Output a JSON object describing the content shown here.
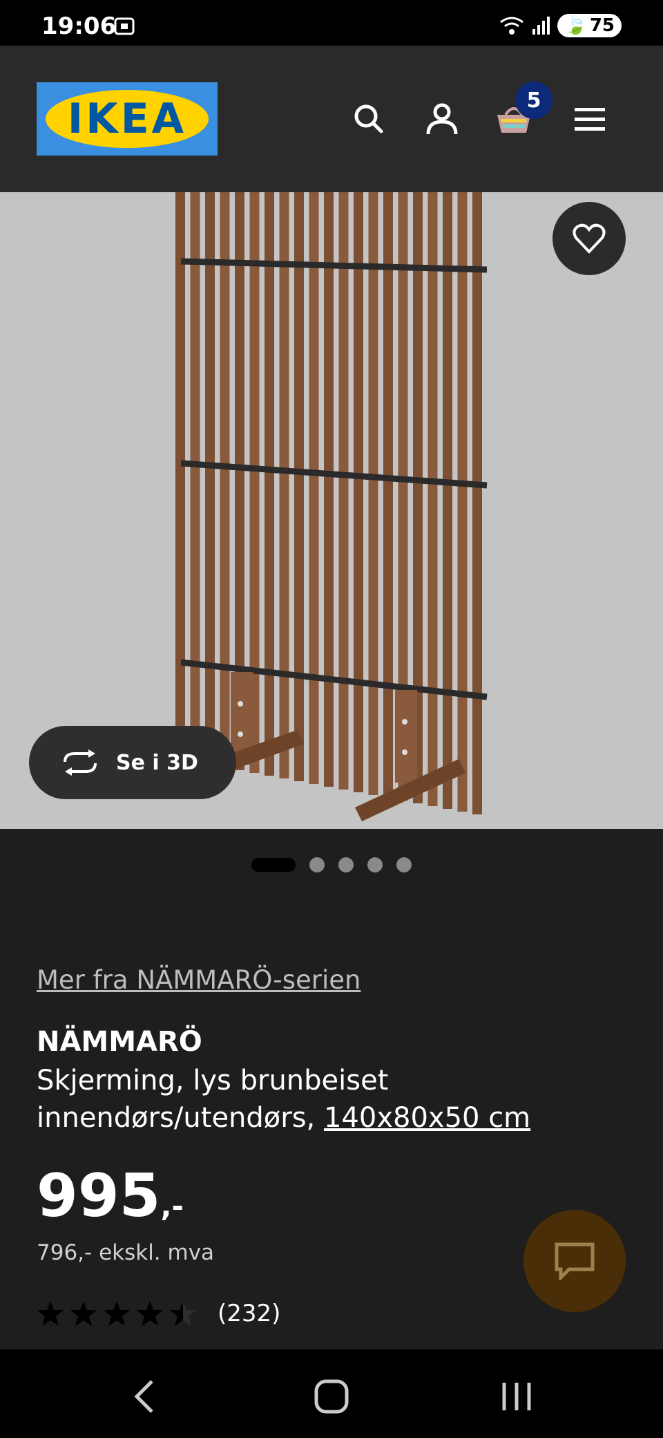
{
  "status_bar": {
    "time": "19:06",
    "battery": "75"
  },
  "header": {
    "logo_text": "IKEA",
    "cart_count": "5",
    "icons": [
      "search-icon",
      "user-icon",
      "cart-icon",
      "menu-icon"
    ]
  },
  "hero": {
    "see_3d_label": "Se i 3D",
    "carousel_total": 5,
    "carousel_active": 1
  },
  "product": {
    "series_link": "Mer fra NÄMMARÖ-serien",
    "name": "NÄMMARÖ",
    "description_line1": "Skjerming, lys brunbeiset",
    "description_line2": "innendørs/utendørs,",
    "size_link": "140x80x50 cm",
    "price": "995",
    "price_suffix": ",-",
    "price_excl_vat": "796,- ekskl. mva",
    "rating_value": 4.5,
    "rating_max": 5,
    "review_count": "(232)"
  },
  "colors": {
    "logo_blue": "#3b8fe0",
    "logo_yellow": "#ffd200",
    "badge_blue": "#0b2a7a",
    "wood": "#8a5a3c"
  }
}
